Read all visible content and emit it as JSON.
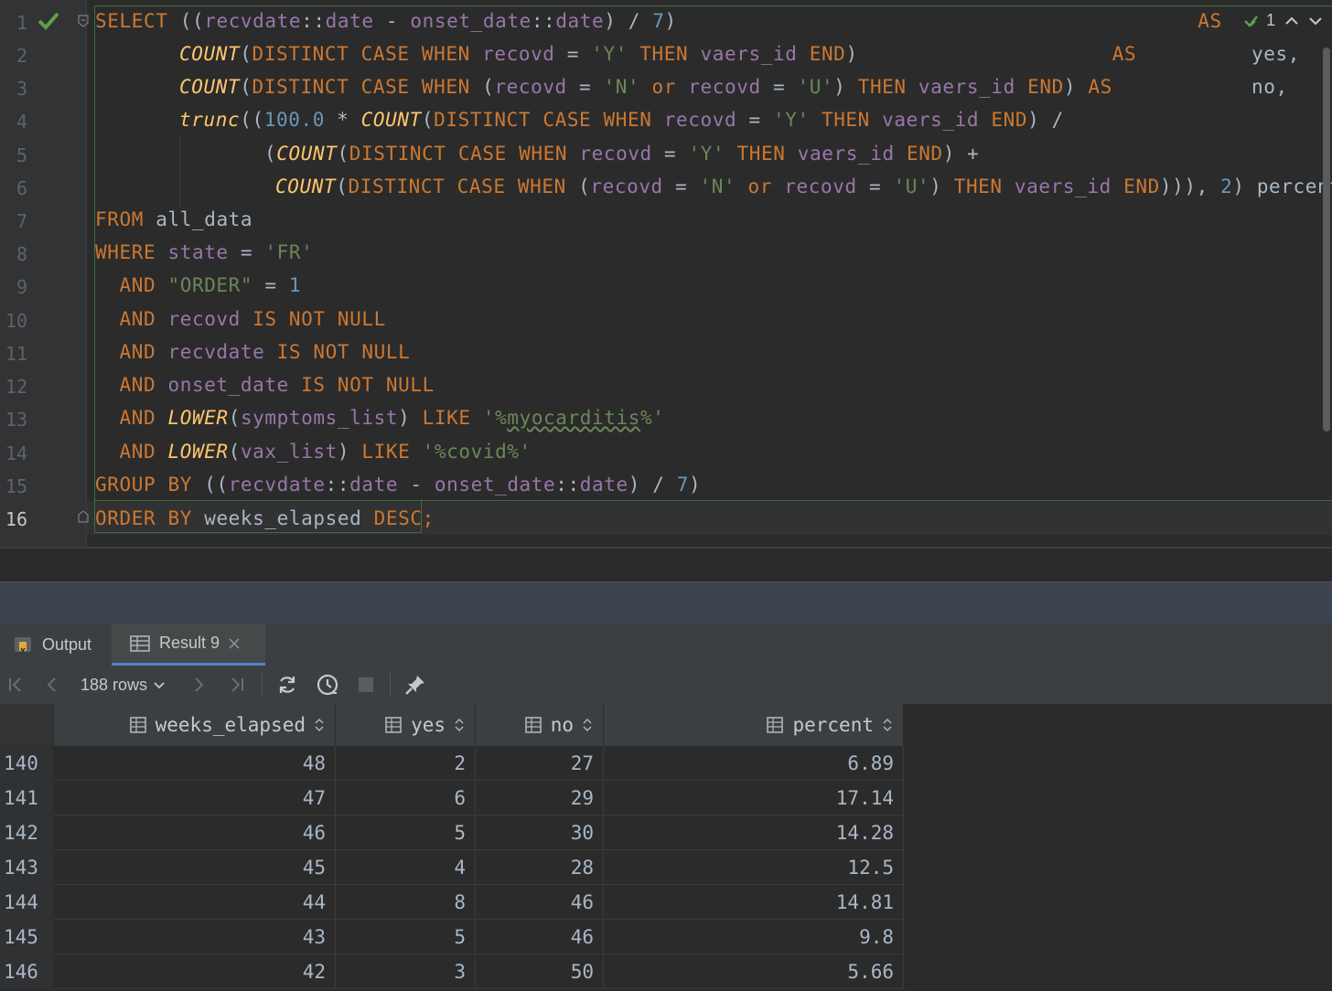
{
  "editor": {
    "line_numbers": [
      "1",
      "2",
      "3",
      "4",
      "5",
      "6",
      "7",
      "8",
      "9",
      "10",
      "11",
      "12",
      "13",
      "14",
      "15",
      "16"
    ],
    "current_line": "16",
    "inspection_count": "1",
    "code": {
      "l1": {
        "a": "SELECT",
        "b": " ((",
        "c": "recvdate",
        "d": "::",
        "e": "date",
        "f": " - ",
        "g": "onset_date",
        "h": "::",
        "i": "date",
        ")": ") / ",
        "n": "7",
        "z": ")",
        "pad": "                                           ",
        "as": "AS"
      },
      "l2": {
        "fn": "COUNT",
        "p": "(",
        "k1": "DISTINCT CASE WHEN ",
        "c1": "recovd",
        " eq": " = ",
        "s1": "'Y'",
        "k2": " THEN ",
        "c2": "vaers_id",
        "k3": " END",
        ")": ")",
        "pad": "                     ",
        "as": "AS"
      },
      "l3": {
        "fn": "COUNT",
        "p": "(",
        "k1": "DISTINCT CASE WHEN ",
        "w1": "(",
        "c1": "recovd",
        "eq1": " = ",
        "s1": "'N'",
        "k2": " or ",
        "c2": "recovd",
        "eq2": " = ",
        "s2": "'U'",
        "w2": ")",
        "k3": " THEN ",
        "c3": "vaers_id",
        "k4": " END",
        ")": ") ",
        "as": "AS"
      },
      "l4": {
        "fn": "trunc",
        "p": "((",
        "n": "100.0",
        "m": " * ",
        "fn2": "COUNT",
        "p2": "(",
        "k1": "DISTINCT CASE WHEN ",
        "c1": "recovd",
        "eq": " = ",
        "s1": "'Y'",
        "k2": " THEN ",
        "c2": "vaers_id",
        "k3": " END",
        "e": ") /"
      },
      "l5": {
        "p": "(",
        "fn": "COUNT",
        "p2": "(",
        "k1": "DISTINCT CASE WHEN ",
        "c1": "recovd",
        "eq": " = ",
        "s1": "'Y'",
        "k2": " THEN ",
        "c2": "vaers_id",
        "k3": " END",
        "e": ") +"
      },
      "l6": {
        "fn": "COUNT",
        "p": "(",
        "k1": "DISTINCT CASE WHEN ",
        "w1": "(",
        "c1": "recovd",
        "eq1": " = ",
        "s1": "'N'",
        "k2": " or ",
        "c2": "recovd",
        "eq2": " = ",
        "s2": "'U'",
        "w2": ")",
        "k3": " THEN ",
        "c3": "vaers_id",
        "k4": " END",
        "e": "))), ",
        "n": "2",
        "z": ") percent"
      },
      "l7": {
        "k": "FROM",
        "w": " all_data"
      },
      "l8": {
        "k": "WHERE",
        "c": " state",
        "w": " = ",
        "s": "'FR'"
      },
      "l9": {
        "k": "  AND",
        "s": " \"ORDER\"",
        "w": " = ",
        "n": "1"
      },
      "l10": {
        "k": "  AND",
        "c": " recovd",
        "k2": " IS NOT NULL"
      },
      "l11": {
        "k": "  AND",
        "c": " recvdate",
        "k2": " IS NOT NULL"
      },
      "l12": {
        "k": "  AND",
        "c": " onset_date",
        "k2": " IS NOT NULL"
      },
      "l13": {
        "k": "  AND",
        "fn": " LOWER",
        "p": "(",
        "c": "symptoms_list",
        "w": ")",
        "k2": " LIKE ",
        "s1": "'%",
        "s2": "myocarditis",
        "s3": "%'"
      },
      "l14": {
        "k": "  AND",
        "fn": " LOWER",
        "p": "(",
        "c": "vax_list",
        "w": ")",
        "k2": " LIKE ",
        "s": "'%covid%'"
      },
      "l15": {
        "k": "GROUP BY",
        "w": " ((",
        "c": "recvdate",
        "d": "::",
        "e": "date",
        "f": " - ",
        "g": "onset_date",
        "h": "::",
        "i": "date",
        "j": ") / ",
        "n": "7",
        "z": ")"
      },
      "l16": {
        "k": "ORDER BY",
        "w": " weeks_elapsed",
        "k2": " DESC",
        "p": ";"
      },
      "alias_yes": "yes,",
      "alias_no": "no,"
    }
  },
  "tool_window": {
    "tabs": [
      {
        "label": "Output",
        "icon": "output-icon"
      },
      {
        "label": "Result 9",
        "icon": "table-icon",
        "closable": true
      }
    ],
    "rows_label": "188 rows",
    "toolbar_icons": [
      "first-page-icon",
      "prev-page-icon",
      "next-page-icon",
      "last-page-icon",
      "refresh-icon",
      "history-icon",
      "stop-icon",
      "pin-icon"
    ]
  },
  "grid": {
    "columns": [
      "weeks_elapsed",
      "yes",
      "no",
      "percent"
    ],
    "rows": [
      {
        "n": "140",
        "v": [
          "48",
          "2",
          "27",
          "6.89"
        ]
      },
      {
        "n": "141",
        "v": [
          "47",
          "6",
          "29",
          "17.14"
        ]
      },
      {
        "n": "142",
        "v": [
          "46",
          "5",
          "30",
          "14.28"
        ]
      },
      {
        "n": "143",
        "v": [
          "45",
          "4",
          "28",
          "12.5"
        ]
      },
      {
        "n": "144",
        "v": [
          "44",
          "8",
          "46",
          "14.81"
        ]
      },
      {
        "n": "145",
        "v": [
          "43",
          "5",
          "46",
          "9.8"
        ]
      },
      {
        "n": "146",
        "v": [
          "42",
          "3",
          "50",
          "5.66"
        ]
      }
    ]
  },
  "colors": {
    "keyword": "#cc7832",
    "function": "#ffc66d",
    "column": "#9876aa",
    "string": "#6a8759",
    "number": "#6897bb",
    "accent": "#4a88c7"
  }
}
